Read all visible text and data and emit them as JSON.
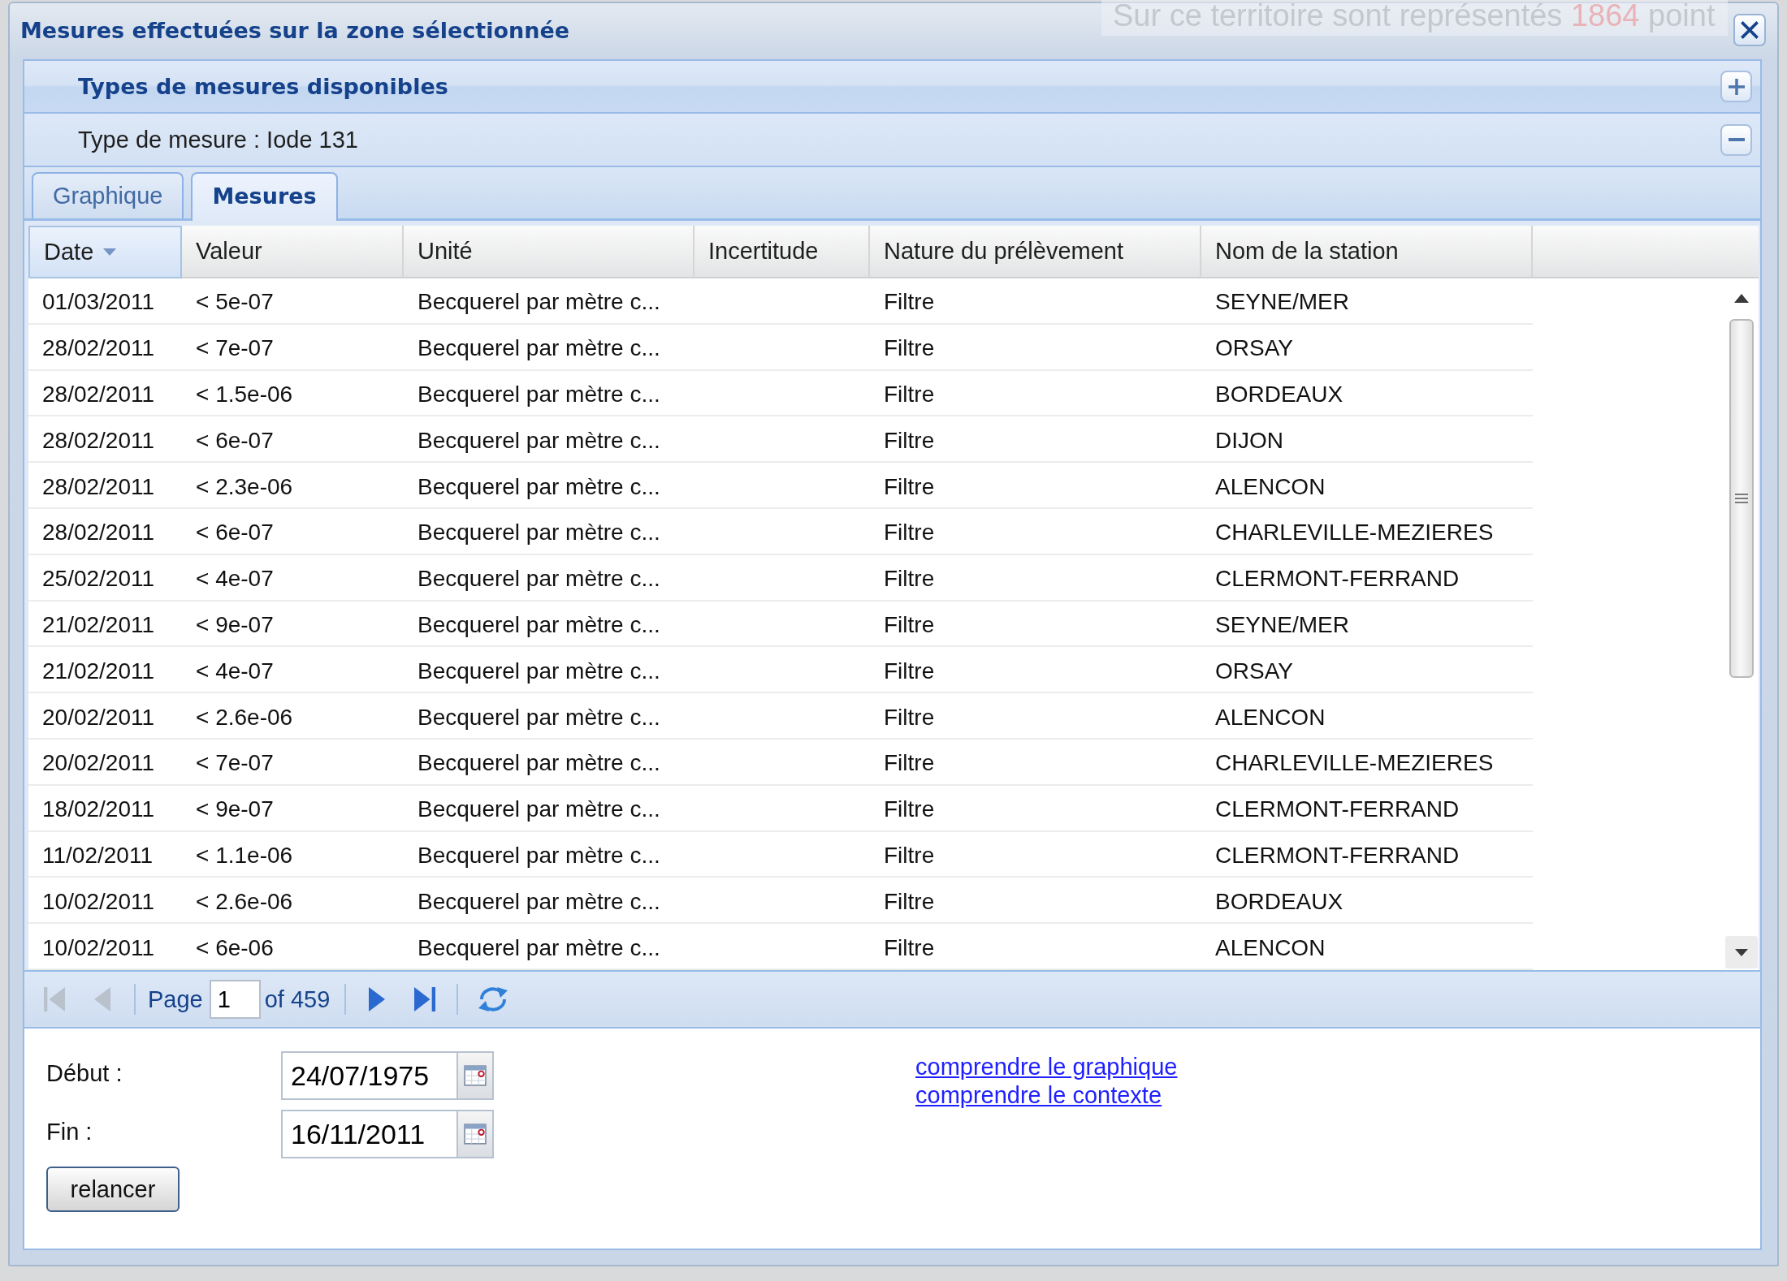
{
  "window": {
    "title": "Mesures effectuées sur la zone sélectionnée",
    "map_overlay": {
      "text_before": "Sur ce territoire sont représentés",
      "count": "1864",
      "text_after": "point"
    }
  },
  "panels": [
    {
      "title": "Types de mesures disponibles",
      "expanded": false
    },
    {
      "title": "Type de mesure : Iode 131",
      "expanded": true
    }
  ],
  "tabs": [
    {
      "label": "Graphique",
      "selected": false
    },
    {
      "label": "Mesures",
      "selected": true
    }
  ],
  "table": {
    "columns": [
      {
        "label": "Date",
        "sorted": true
      },
      {
        "label": "Valeur",
        "sorted": false
      },
      {
        "label": "Unité",
        "sorted": false
      },
      {
        "label": "Incertitude",
        "sorted": false
      },
      {
        "label": "Nature du prélèvement",
        "sorted": false
      },
      {
        "label": "Nom de la station",
        "sorted": false
      }
    ],
    "rows": [
      {
        "date": "01/03/2011",
        "value": "< 5e-07",
        "unit": "Becquerel par mètre c...",
        "nature": "Filtre",
        "station": "SEYNE/MER"
      },
      {
        "date": "28/02/2011",
        "value": "< 7e-07",
        "unit": "Becquerel par mètre c...",
        "nature": "Filtre",
        "station": "ORSAY"
      },
      {
        "date": "28/02/2011",
        "value": "< 1.5e-06",
        "unit": "Becquerel par mètre c...",
        "nature": "Filtre",
        "station": "BORDEAUX"
      },
      {
        "date": "28/02/2011",
        "value": "< 6e-07",
        "unit": "Becquerel par mètre c...",
        "nature": "Filtre",
        "station": "DIJON"
      },
      {
        "date": "28/02/2011",
        "value": "< 2.3e-06",
        "unit": "Becquerel par mètre c...",
        "nature": "Filtre",
        "station": "ALENCON"
      },
      {
        "date": "28/02/2011",
        "value": "< 6e-07",
        "unit": "Becquerel par mètre c...",
        "nature": "Filtre",
        "station": "CHARLEVILLE-MEZIERES"
      },
      {
        "date": "25/02/2011",
        "value": "< 4e-07",
        "unit": "Becquerel par mètre c...",
        "nature": "Filtre",
        "station": "CLERMONT-FERRAND"
      },
      {
        "date": "21/02/2011",
        "value": "< 9e-07",
        "unit": "Becquerel par mètre c...",
        "nature": "Filtre",
        "station": "SEYNE/MER"
      },
      {
        "date": "21/02/2011",
        "value": "< 4e-07",
        "unit": "Becquerel par mètre c...",
        "nature": "Filtre",
        "station": "ORSAY"
      },
      {
        "date": "20/02/2011",
        "value": "< 2.6e-06",
        "unit": "Becquerel par mètre c...",
        "nature": "Filtre",
        "station": "ALENCON"
      },
      {
        "date": "20/02/2011",
        "value": "< 7e-07",
        "unit": "Becquerel par mètre c...",
        "nature": "Filtre",
        "station": "CHARLEVILLE-MEZIERES"
      },
      {
        "date": "18/02/2011",
        "value": "< 9e-07",
        "unit": "Becquerel par mètre c...",
        "nature": "Filtre",
        "station": "CLERMONT-FERRAND"
      },
      {
        "date": "11/02/2011",
        "value": "< 1.1e-06",
        "unit": "Becquerel par mètre c...",
        "nature": "Filtre",
        "station": "CLERMONT-FERRAND"
      },
      {
        "date": "10/02/2011",
        "value": "< 2.6e-06",
        "unit": "Becquerel par mètre c...",
        "nature": "Filtre",
        "station": "BORDEAUX"
      },
      {
        "date": "10/02/2011",
        "value": "< 6e-06",
        "unit": "Becquerel par mètre c...",
        "nature": "Filtre",
        "station": "ALENCON"
      }
    ]
  },
  "pager": {
    "buttons": [
      {
        "kind": "first",
        "disabled": true
      },
      {
        "kind": "prev",
        "disabled": true
      },
      {
        "kind": "next",
        "disabled": false
      },
      {
        "kind": "last",
        "disabled": false
      },
      {
        "kind": "refresh",
        "disabled": false
      }
    ],
    "page_label": "Page",
    "page": "1",
    "page_count": "of 459"
  },
  "form": {
    "fields": [
      {
        "label": "Début :",
        "value": "24/07/1975"
      },
      {
        "label": "Fin :",
        "value": "16/11/2011"
      }
    ],
    "button": "relancer",
    "links": [
      "comprendre le graphique",
      "comprendre le contexte"
    ]
  }
}
